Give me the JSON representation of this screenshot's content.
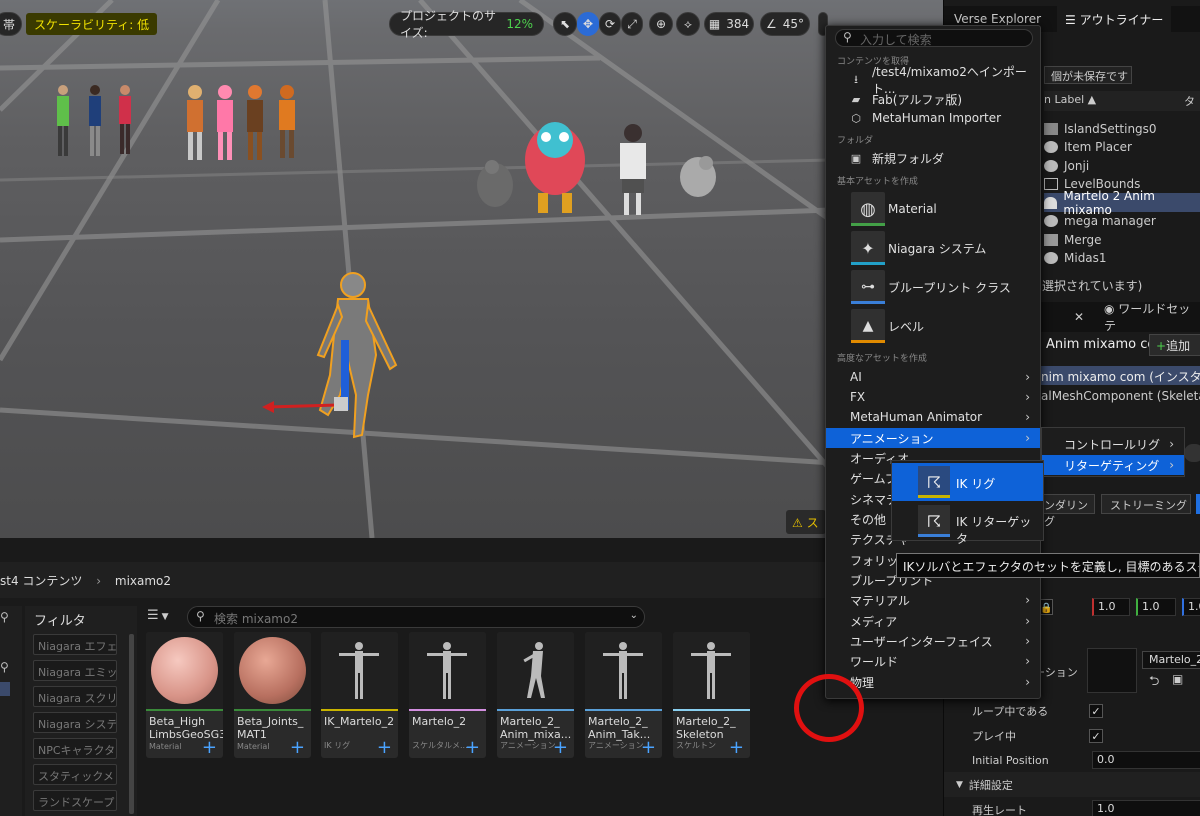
{
  "viewport": {
    "left_label": "帯",
    "scalability": "スケーラビリティ: 低",
    "project_size_label": "プロジェクトのサイズ:",
    "project_size_value": "12%",
    "grid_value": "384",
    "angle_value": "45°",
    "warning_label": "ス"
  },
  "right_panel": {
    "tab_verse": "Verse Explorer",
    "tab_outliner": "アウトライナー",
    "unsaved_label": "個が未保存です",
    "column_label": "n Label",
    "outliner_items": [
      "IslandSettings0",
      "Item Placer",
      "Jonji",
      "LevelBounds",
      "Martelo 2 Anim mixamo",
      "mega manager",
      "Merge",
      "Midas1"
    ],
    "selected_status": "選択されています)",
    "world_settings_tab": "ワールドセッテ",
    "details_name": "Anim mixamo co",
    "add_button": "追加",
    "instance_label": "nim mixamo com (インスタンス",
    "component_label": "alMeshComponent (SkeletalMe",
    "rendering_btn": "ンダリング",
    "streaming_btn": "ストリーミング",
    "anim_label": "ーション",
    "anim_asset": "Martelo_2",
    "scale_values": [
      "1.0",
      "1.0",
      "1.0"
    ],
    "loop_label": "ループ中である",
    "play_label": "プレイ中",
    "initial_position_label": "Initial Position",
    "initial_position_value": "0.0",
    "detail_settings": "詳細設定",
    "playback_rate_label": "再生レート",
    "playback_rate_value": "1.0"
  },
  "content_browser": {
    "path_root": "st4 コンテンツ",
    "path_folder": "mixamo2",
    "filter_title": "フィルタ",
    "filters": [
      "Niagara エフェ",
      "Niagara エミッ",
      "Niagara スクリ",
      "Niagara システ",
      "NPCキャラクタ",
      "スタティックメ",
      "ランドスケープ"
    ],
    "search_placeholder": "検索 mixamo2",
    "assets": [
      {
        "name": "Beta_High\nLimbsGeoSG3",
        "type": "Material",
        "bar": "#3a8a3a"
      },
      {
        "name": "Beta_Joints_\nMAT1",
        "type": "Material",
        "bar": "#3a8a3a"
      },
      {
        "name": "IK_Martelo_2",
        "type": "IK リグ",
        "bar": "#c9b400"
      },
      {
        "name": "Martelo_2",
        "type": "スケルタルメ...",
        "bar": "#d38fe0"
      },
      {
        "name": "Martelo_2_\nAnim_mixa...",
        "type": "アニメーション...",
        "bar": "#5aa0d8"
      },
      {
        "name": "Martelo_2_\nAnim_Tak...",
        "type": "アニメーション...",
        "bar": "#5aa0d8"
      },
      {
        "name": "Martelo_2_\nSkeleton",
        "type": "スケルトン",
        "bar": "#8ad0f0"
      }
    ]
  },
  "context_menu": {
    "search_placeholder": "入力して検索",
    "section_get": "コンテンツを取得",
    "get_items": [
      "/test4/mixamo2へインポート...",
      "Fab(アルファ版)",
      "MetaHuman Importer"
    ],
    "section_folder": "フォルダ",
    "new_folder": "新規フォルダ",
    "section_basic": "基本アセットを作成",
    "basic_items": [
      {
        "label": "Material",
        "color": "#43a047"
      },
      {
        "label": "Niagara システム",
        "color": "#22a0c8"
      },
      {
        "label": "ブループリント クラス",
        "color": "#3a7fd8"
      },
      {
        "label": "レベル",
        "color": "#e08a00"
      }
    ],
    "section_advanced": "高度なアセットを作成",
    "advanced_items": [
      "AI",
      "FX",
      "MetaHuman Animator",
      "アニメーション",
      "オーディオ",
      "ゲームプレイ",
      "シネマティックス",
      "その他",
      "テクスチャ",
      "フォリッジ",
      "ブループリント",
      "マテリアル",
      "メディア",
      "ユーザーインターフェイス",
      "ワールド",
      "物理"
    ],
    "anim_submenu": [
      "コントロールリグ",
      "リターゲティング"
    ],
    "retarget_submenu": [
      "IK リグ",
      "IK リターゲッタ"
    ],
    "tooltip": "IKソルバとエフェクタのセットを定義し, 目標のあるスケルトンに"
  }
}
